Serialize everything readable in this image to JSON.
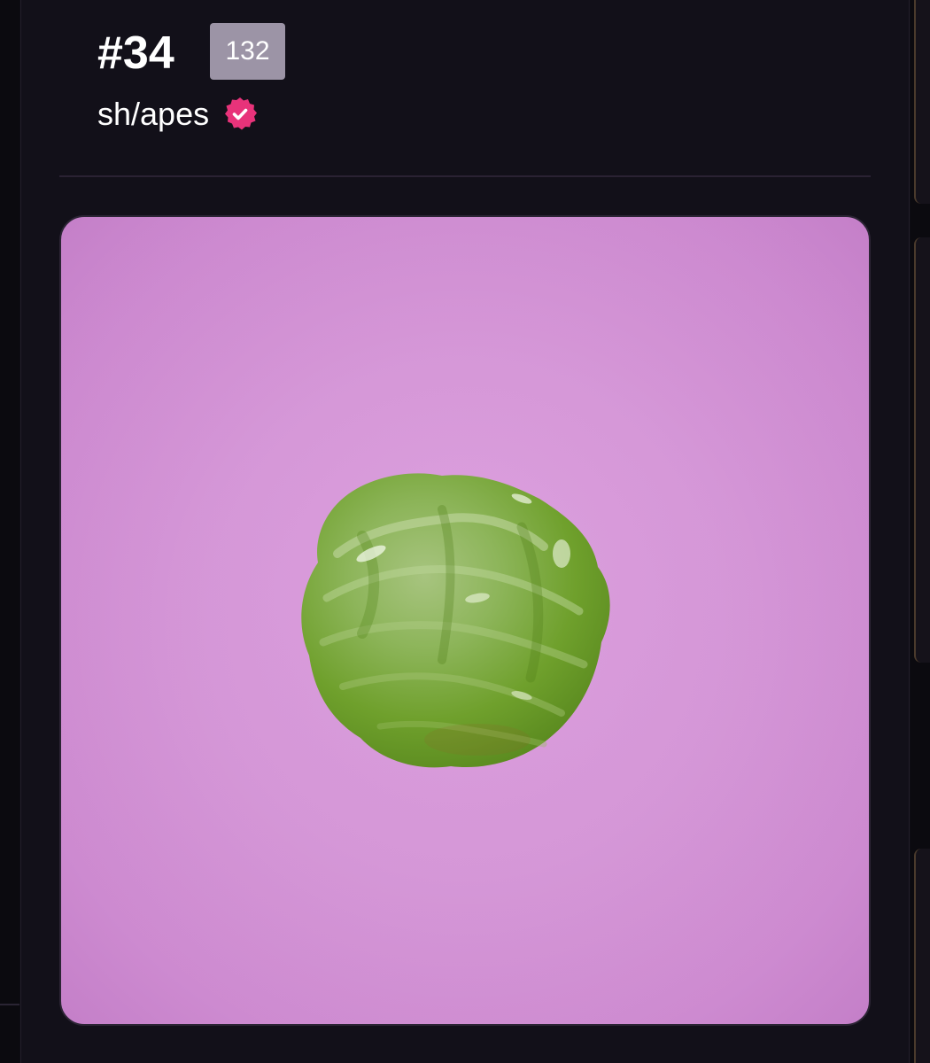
{
  "item": {
    "title": "#34",
    "count": "132",
    "collection": "sh/apes",
    "verified": true
  },
  "artwork": {
    "subject": "green-blob",
    "background_color": "#d89cda",
    "blob_color": "#6fa02c"
  },
  "colors": {
    "background": "#0d0b12",
    "card": "#121019",
    "badge": "#9c94a6",
    "verified_badge": "#e8337a"
  }
}
